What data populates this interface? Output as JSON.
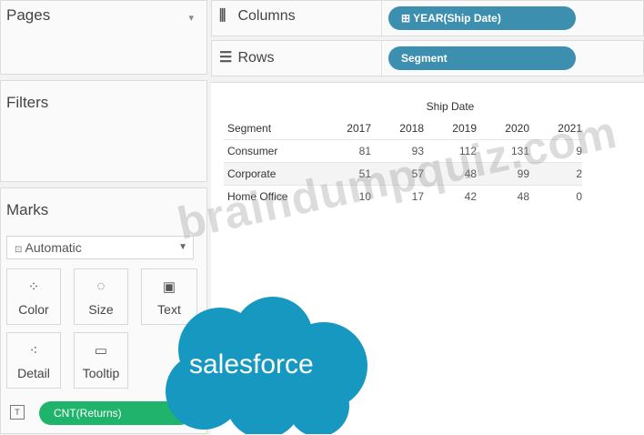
{
  "sidebar": {
    "pages_title": "Pages",
    "filters_title": "Filters",
    "marks_title": "Marks",
    "mark_type": "Automatic",
    "mark_buttons": [
      {
        "label": "Color",
        "icon": "color-dots-icon"
      },
      {
        "label": "Size",
        "icon": "size-icon"
      },
      {
        "label": "Text",
        "icon": "text-icon"
      },
      {
        "label": "Detail",
        "icon": "detail-icon"
      },
      {
        "label": "Tooltip",
        "icon": "tooltip-icon"
      }
    ],
    "mark_pill": "CNT(Returns)"
  },
  "shelves": {
    "columns_label": "Columns",
    "columns_pill": "⊞ YEAR(Ship Date)",
    "rows_label": "Rows",
    "rows_pill": "Segment"
  },
  "view": {
    "header_group": "Ship Date",
    "row_header": "Segment",
    "years": [
      "2017",
      "2018",
      "2019",
      "2020",
      "2021"
    ],
    "rows": [
      {
        "segment": "Consumer",
        "values": [
          "81",
          "93",
          "112",
          "131",
          "9"
        ]
      },
      {
        "segment": "Corporate",
        "values": [
          "51",
          "57",
          "48",
          "99",
          "2"
        ]
      },
      {
        "segment": "Home Office",
        "values": [
          "10",
          "17",
          "42",
          "48",
          "0"
        ]
      }
    ]
  },
  "overlay": {
    "watermark": "braindumpquiz.com",
    "logo_text": "salesforce"
  },
  "colors": {
    "shelf_pill": "#3d8fb0",
    "measure_pill": "#20b36b",
    "logo": "#1798c1"
  }
}
